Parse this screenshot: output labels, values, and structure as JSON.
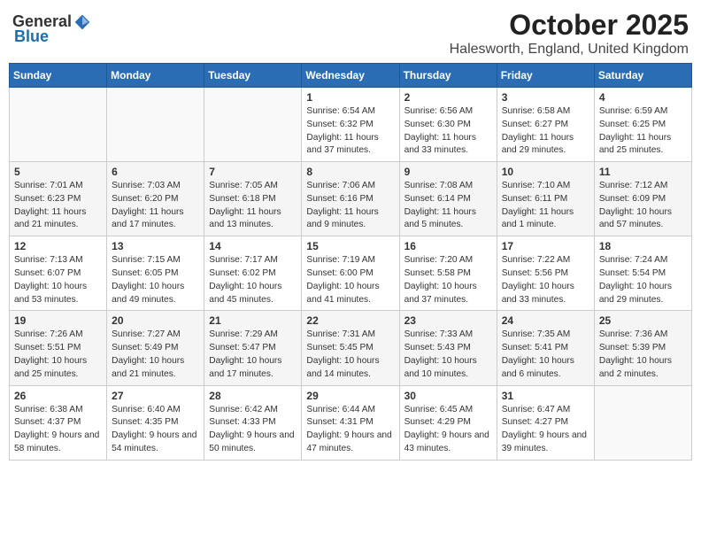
{
  "logo": {
    "general": "General",
    "blue": "Blue"
  },
  "title": "October 2025",
  "subtitle": "Halesworth, England, United Kingdom",
  "weekdays": [
    "Sunday",
    "Monday",
    "Tuesday",
    "Wednesday",
    "Thursday",
    "Friday",
    "Saturday"
  ],
  "rows": [
    [
      {
        "day": "",
        "content": ""
      },
      {
        "day": "",
        "content": ""
      },
      {
        "day": "",
        "content": ""
      },
      {
        "day": "1",
        "content": "Sunrise: 6:54 AM\nSunset: 6:32 PM\nDaylight: 11 hours\nand 37 minutes."
      },
      {
        "day": "2",
        "content": "Sunrise: 6:56 AM\nSunset: 6:30 PM\nDaylight: 11 hours\nand 33 minutes."
      },
      {
        "day": "3",
        "content": "Sunrise: 6:58 AM\nSunset: 6:27 PM\nDaylight: 11 hours\nand 29 minutes."
      },
      {
        "day": "4",
        "content": "Sunrise: 6:59 AM\nSunset: 6:25 PM\nDaylight: 11 hours\nand 25 minutes."
      }
    ],
    [
      {
        "day": "5",
        "content": "Sunrise: 7:01 AM\nSunset: 6:23 PM\nDaylight: 11 hours\nand 21 minutes."
      },
      {
        "day": "6",
        "content": "Sunrise: 7:03 AM\nSunset: 6:20 PM\nDaylight: 11 hours\nand 17 minutes."
      },
      {
        "day": "7",
        "content": "Sunrise: 7:05 AM\nSunset: 6:18 PM\nDaylight: 11 hours\nand 13 minutes."
      },
      {
        "day": "8",
        "content": "Sunrise: 7:06 AM\nSunset: 6:16 PM\nDaylight: 11 hours\nand 9 minutes."
      },
      {
        "day": "9",
        "content": "Sunrise: 7:08 AM\nSunset: 6:14 PM\nDaylight: 11 hours\nand 5 minutes."
      },
      {
        "day": "10",
        "content": "Sunrise: 7:10 AM\nSunset: 6:11 PM\nDaylight: 11 hours\nand 1 minute."
      },
      {
        "day": "11",
        "content": "Sunrise: 7:12 AM\nSunset: 6:09 PM\nDaylight: 10 hours\nand 57 minutes."
      }
    ],
    [
      {
        "day": "12",
        "content": "Sunrise: 7:13 AM\nSunset: 6:07 PM\nDaylight: 10 hours\nand 53 minutes."
      },
      {
        "day": "13",
        "content": "Sunrise: 7:15 AM\nSunset: 6:05 PM\nDaylight: 10 hours\nand 49 minutes."
      },
      {
        "day": "14",
        "content": "Sunrise: 7:17 AM\nSunset: 6:02 PM\nDaylight: 10 hours\nand 45 minutes."
      },
      {
        "day": "15",
        "content": "Sunrise: 7:19 AM\nSunset: 6:00 PM\nDaylight: 10 hours\nand 41 minutes."
      },
      {
        "day": "16",
        "content": "Sunrise: 7:20 AM\nSunset: 5:58 PM\nDaylight: 10 hours\nand 37 minutes."
      },
      {
        "day": "17",
        "content": "Sunrise: 7:22 AM\nSunset: 5:56 PM\nDaylight: 10 hours\nand 33 minutes."
      },
      {
        "day": "18",
        "content": "Sunrise: 7:24 AM\nSunset: 5:54 PM\nDaylight: 10 hours\nand 29 minutes."
      }
    ],
    [
      {
        "day": "19",
        "content": "Sunrise: 7:26 AM\nSunset: 5:51 PM\nDaylight: 10 hours\nand 25 minutes."
      },
      {
        "day": "20",
        "content": "Sunrise: 7:27 AM\nSunset: 5:49 PM\nDaylight: 10 hours\nand 21 minutes."
      },
      {
        "day": "21",
        "content": "Sunrise: 7:29 AM\nSunset: 5:47 PM\nDaylight: 10 hours\nand 17 minutes."
      },
      {
        "day": "22",
        "content": "Sunrise: 7:31 AM\nSunset: 5:45 PM\nDaylight: 10 hours\nand 14 minutes."
      },
      {
        "day": "23",
        "content": "Sunrise: 7:33 AM\nSunset: 5:43 PM\nDaylight: 10 hours\nand 10 minutes."
      },
      {
        "day": "24",
        "content": "Sunrise: 7:35 AM\nSunset: 5:41 PM\nDaylight: 10 hours\nand 6 minutes."
      },
      {
        "day": "25",
        "content": "Sunrise: 7:36 AM\nSunset: 5:39 PM\nDaylight: 10 hours\nand 2 minutes."
      }
    ],
    [
      {
        "day": "26",
        "content": "Sunrise: 6:38 AM\nSunset: 4:37 PM\nDaylight: 9 hours\nand 58 minutes."
      },
      {
        "day": "27",
        "content": "Sunrise: 6:40 AM\nSunset: 4:35 PM\nDaylight: 9 hours\nand 54 minutes."
      },
      {
        "day": "28",
        "content": "Sunrise: 6:42 AM\nSunset: 4:33 PM\nDaylight: 9 hours\nand 50 minutes."
      },
      {
        "day": "29",
        "content": "Sunrise: 6:44 AM\nSunset: 4:31 PM\nDaylight: 9 hours\nand 47 minutes."
      },
      {
        "day": "30",
        "content": "Sunrise: 6:45 AM\nSunset: 4:29 PM\nDaylight: 9 hours\nand 43 minutes."
      },
      {
        "day": "31",
        "content": "Sunrise: 6:47 AM\nSunset: 4:27 PM\nDaylight: 9 hours\nand 39 minutes."
      },
      {
        "day": "",
        "content": ""
      }
    ]
  ]
}
